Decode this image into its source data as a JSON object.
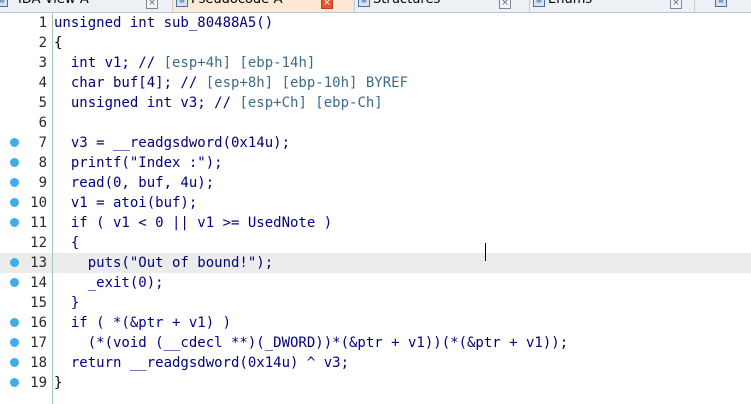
{
  "tabs": [
    {
      "label": "IDA View-A",
      "icon": "ida-view-icon",
      "close": "close-icon",
      "active": false
    },
    {
      "label": "Pseudocode-A",
      "icon": "pseudocode-icon",
      "close": "close-icon",
      "active": true
    },
    {
      "label": "Structures",
      "icon": "structures-icon",
      "close": "close-icon",
      "active": false
    },
    {
      "label": "Enums",
      "icon": "enums-icon",
      "close": "close-icon",
      "active": false
    }
  ],
  "colors": {
    "keyword": "#000080",
    "comment": "#3d6b8a",
    "plain": "#000080",
    "black": "#000000",
    "function": "#000080"
  },
  "lines": [
    {
      "n": "1",
      "bp": false,
      "hl": false,
      "tokens": [
        [
          "unsigned int sub_80488A5()",
          "kw"
        ]
      ]
    },
    {
      "n": "2",
      "bp": false,
      "hl": false,
      "tokens": [
        [
          "{",
          "bk"
        ]
      ]
    },
    {
      "n": "3",
      "bp": false,
      "hl": false,
      "tokens": [
        [
          "  int v1; // ",
          "kw"
        ],
        [
          "[esp+4h] [ebp-14h]",
          "cm"
        ]
      ]
    },
    {
      "n": "4",
      "bp": false,
      "hl": false,
      "tokens": [
        [
          "  char buf[4]; // ",
          "kw"
        ],
        [
          "[esp+8h] [ebp-10h] BYREF",
          "cm"
        ]
      ]
    },
    {
      "n": "5",
      "bp": false,
      "hl": false,
      "tokens": [
        [
          "  unsigned int v3; // ",
          "kw"
        ],
        [
          "[esp+Ch] [ebp-Ch]",
          "cm"
        ]
      ]
    },
    {
      "n": "6",
      "bp": false,
      "hl": false,
      "tokens": [
        [
          "",
          "kw"
        ]
      ]
    },
    {
      "n": "7",
      "bp": true,
      "hl": false,
      "tokens": [
        [
          "  v3 = __readgsdword(0x14u);",
          "kw"
        ]
      ]
    },
    {
      "n": "8",
      "bp": true,
      "hl": false,
      "tokens": [
        [
          "  printf(\"Index :\");",
          "kw"
        ]
      ]
    },
    {
      "n": "9",
      "bp": true,
      "hl": false,
      "tokens": [
        [
          "  read(0, buf, 4u);",
          "kw"
        ]
      ]
    },
    {
      "n": "10",
      "bp": true,
      "hl": false,
      "tokens": [
        [
          "  v1 = atoi(buf);",
          "kw"
        ]
      ]
    },
    {
      "n": "11",
      "bp": true,
      "hl": false,
      "tokens": [
        [
          "  if ( v1 < 0 || v1 >= UsedNote )",
          "kw"
        ]
      ]
    },
    {
      "n": "12",
      "bp": false,
      "hl": false,
      "tokens": [
        [
          "  {",
          "kw"
        ]
      ]
    },
    {
      "n": "13",
      "bp": true,
      "hl": true,
      "tokens": [
        [
          "    puts(\"Out of bound!\");",
          "kw"
        ]
      ]
    },
    {
      "n": "14",
      "bp": true,
      "hl": false,
      "tokens": [
        [
          "    _exit(0);",
          "kw"
        ]
      ]
    },
    {
      "n": "15",
      "bp": false,
      "hl": false,
      "tokens": [
        [
          "  }",
          "kw"
        ]
      ]
    },
    {
      "n": "16",
      "bp": true,
      "hl": false,
      "tokens": [
        [
          "  if ( *(&ptr + v1) )",
          "kw"
        ]
      ]
    },
    {
      "n": "17",
      "bp": true,
      "hl": false,
      "tokens": [
        [
          "    (*(void (__cdecl **)(_DWORD))*(&ptr + v1))(*(&ptr + v1));",
          "kw"
        ]
      ]
    },
    {
      "n": "18",
      "bp": true,
      "hl": false,
      "tokens": [
        [
          "  return __readgsdword(0x14u) ^ v3;",
          "kw"
        ]
      ]
    },
    {
      "n": "19",
      "bp": true,
      "hl": false,
      "tokens": [
        [
          "}",
          "bk"
        ]
      ]
    }
  ]
}
